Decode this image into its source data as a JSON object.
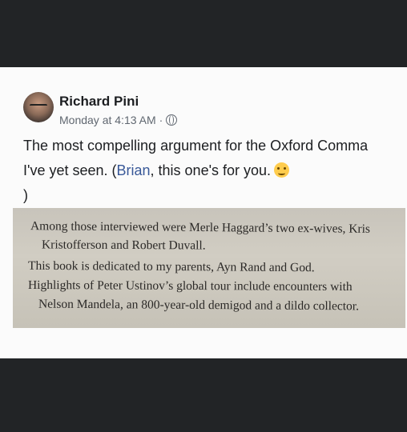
{
  "post": {
    "author": "Richard Pini",
    "timestamp": "Monday at 4:13 AM",
    "separator": "·",
    "audience_icon": "globe-icon",
    "text_before_link": "The most compelling argument for the Oxford Comma I've yet seen. (",
    "mention": "Brian",
    "text_after_link": ", this one's for you.",
    "emoji": "winking-face",
    "closing": ")"
  },
  "book_excerpt": {
    "lines": [
      "Among those interviewed were Merle Haggard’s two ex-wives, Kris",
      "Kristofferson and Robert Duvall.",
      "This book is dedicated to my parents, Ayn Rand and God.",
      "Highlights of Peter Ustinov’s global tour include encounters with",
      "Nelson Mandela, an 800-year-old demigod and a dildo collector."
    ]
  }
}
